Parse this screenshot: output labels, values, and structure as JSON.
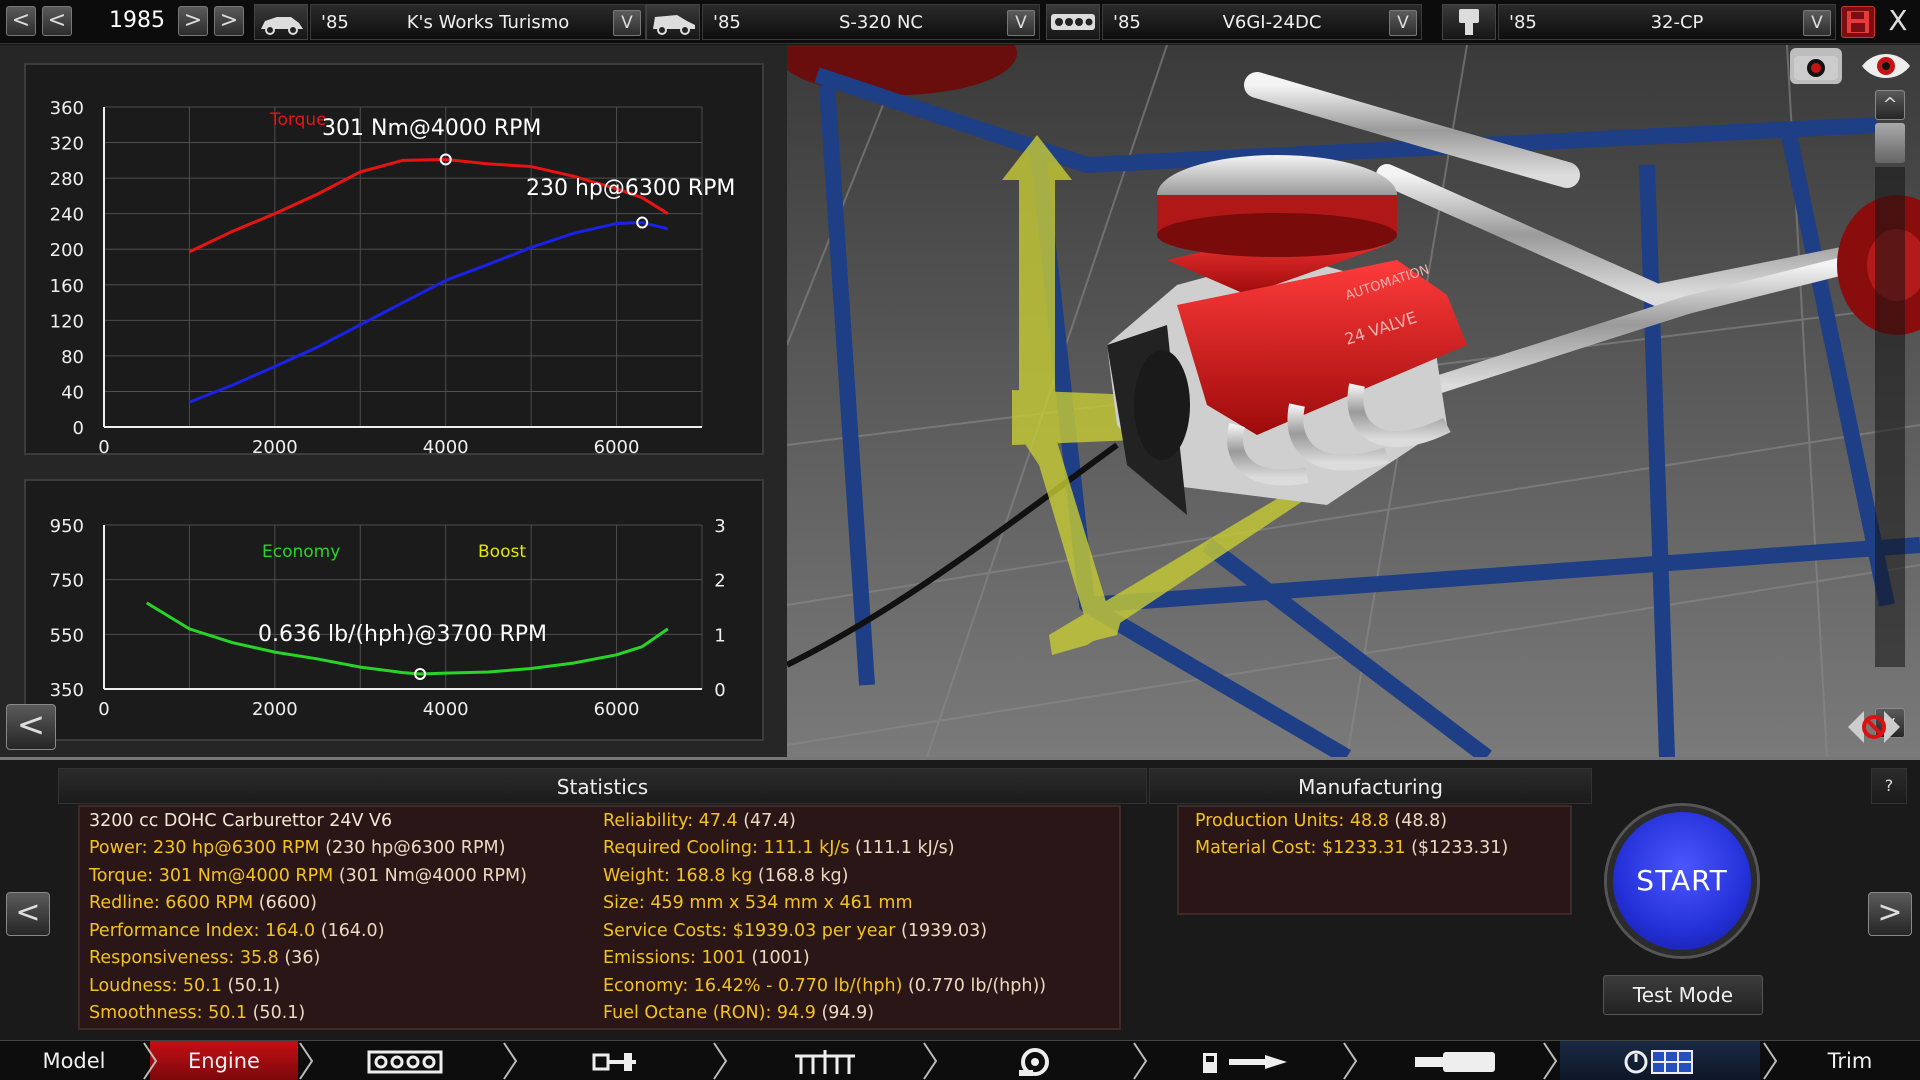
{
  "topbar": {
    "year": "1985",
    "fields": [
      {
        "year": "'85",
        "name": "K's Works Turismo",
        "icon": "car-body-icon"
      },
      {
        "year": "'85",
        "name": "S-320 NC",
        "icon": "car-trim-icon"
      },
      {
        "year": "'85",
        "name": "V6GI-24DC",
        "icon": "engine-block-icon"
      },
      {
        "year": "'85",
        "name": "32-CP",
        "icon": "piston-icon"
      }
    ],
    "prev_label": "<",
    "next_label": ">",
    "dropdown_label": "V",
    "close_label": "X"
  },
  "torque_graph": {
    "y_ticks": [
      "360",
      "320",
      "280",
      "240",
      "200",
      "160",
      "120",
      "80",
      "40",
      "0"
    ],
    "x_ticks": [
      "0",
      "2000",
      "4000",
      "6000"
    ],
    "legend_torque": "Torque",
    "peak_torque_label": "301 Nm@4000 RPM",
    "peak_power_label": "230 hp@6300 RPM",
    "colors": {
      "torque": "#e81414",
      "power": "#1a22e8"
    }
  },
  "economy_graph": {
    "y_ticks_left": [
      "950",
      "750",
      "550",
      "350"
    ],
    "y_ticks_right": [
      "3",
      "2",
      "1",
      "0"
    ],
    "x_ticks": [
      "0",
      "2000",
      "4000",
      "6000"
    ],
    "legend_economy": "Economy",
    "legend_boost": "Boost",
    "best_label": "0.636 lb/(hph)@3700 RPM",
    "colors": {
      "economy": "#28d428",
      "boost": "#e6e600"
    }
  },
  "graph_back_label": "<",
  "chart_data": [
    {
      "type": "line",
      "xlabel": "",
      "ylabel": "",
      "xlim": [
        0,
        7000
      ],
      "ylim": [
        0,
        360
      ],
      "series": [
        {
          "name": "Torque",
          "x": [
            1000,
            1500,
            2000,
            2500,
            3000,
            3500,
            4000,
            4500,
            5000,
            5500,
            6000,
            6300,
            6600
          ],
          "values": [
            197,
            220,
            240,
            262,
            287,
            300,
            301,
            296,
            293,
            282,
            268,
            258,
            240
          ]
        },
        {
          "x": [
            1000,
            1500,
            2000,
            2500,
            3000,
            3500,
            4000,
            4500,
            5000,
            5500,
            6000,
            6300,
            6600
          ],
          "values": [
            28,
            47,
            68,
            90,
            115,
            140,
            165,
            183,
            202,
            218,
            229,
            230,
            223
          ]
        }
      ]
    },
    {
      "type": "line",
      "xlabel": "",
      "ylabel": "",
      "xlim": [
        0,
        7000
      ],
      "ylim": [
        350,
        950
      ],
      "series": [
        {
          "name": "Economy",
          "x": [
            500,
            1000,
            1500,
            2000,
            2500,
            3000,
            3500,
            3700,
            4000,
            4500,
            5000,
            5500,
            6000,
            6300,
            6600
          ],
          "values": [
            665,
            570,
            520,
            485,
            460,
            430,
            410,
            405,
            408,
            412,
            425,
            445,
            475,
            505,
            570
          ]
        }
      ]
    }
  ],
  "statistics": {
    "title": "Statistics",
    "left": [
      {
        "plain": "3200 cc DOHC Carburettor 24V V6"
      },
      {
        "v": "Power: 230 hp@6300 RPM",
        "p": " (230 hp@6300 RPM)"
      },
      {
        "v": "Torque: 301 Nm@4000 RPM",
        "p": " (301 Nm@4000 RPM)"
      },
      {
        "v": "Redline: 6600 RPM",
        "p": " (6600)"
      },
      {
        "v": "Performance Index: 164.0",
        "p": " (164.0)"
      },
      {
        "v": "Responsiveness: 35.8",
        "p": " (36)"
      },
      {
        "v": "Loudness: 50.1",
        "p": " (50.1)"
      },
      {
        "v": "Smoothness: 50.1",
        "p": " (50.1)"
      }
    ],
    "right": [
      {
        "v": "Reliability: 47.4",
        "p": " (47.4)"
      },
      {
        "v": "Required Cooling: 111.1 kJ/s",
        "p": " (111.1 kJ/s)"
      },
      {
        "v": "Weight: 168.8 kg",
        "p": " (168.8 kg)"
      },
      {
        "v": "Size: 459 mm x 534 mm x 461 mm",
        "p": ""
      },
      {
        "v": "Service Costs: $1939.03 per year",
        "p": " (1939.03)"
      },
      {
        "v": "Emissions: 1001",
        "p": " (1001)"
      },
      {
        "v": "Economy: 16.42% - 0.770 lb/(hph)",
        "p": " (0.770 lb/(hph))"
      },
      {
        "v": "Fuel Octane (RON): 94.9",
        "p": " (94.9)"
      }
    ]
  },
  "manufacturing": {
    "title": "Manufacturing",
    "rows": [
      {
        "v": "Production Units: 48.8",
        "p": " (48.8)"
      },
      {
        "v": "Material Cost: $1233.31",
        "p": " ($1233.31)"
      }
    ]
  },
  "help_label": "?",
  "start_label": "START",
  "test_mode_label": "Test Mode",
  "side_prev": "<",
  "side_next": ">",
  "viewport": {
    "scroll_up": "^",
    "scroll_down": "v"
  },
  "nav": {
    "model": "Model",
    "engine": "Engine",
    "trim": "Trim",
    "icons": [
      "engine-block-icon",
      "crankshaft-icon",
      "cylinder-head-icon",
      "turbo-icon",
      "fuel-system-icon",
      "exhaust-icon",
      "tuning-icon"
    ]
  }
}
